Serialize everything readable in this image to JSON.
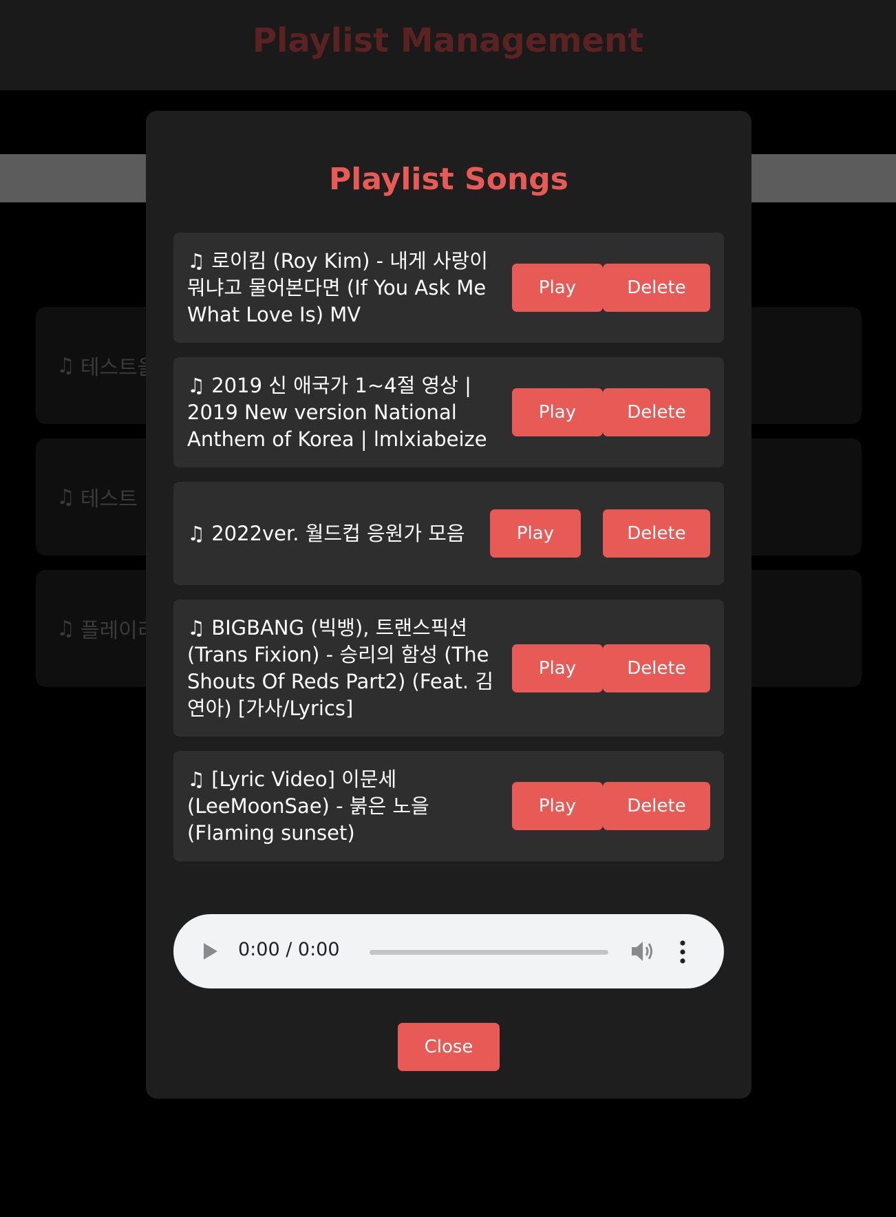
{
  "background": {
    "title": "Playlist Management",
    "cards": [
      {
        "label": "테스트을"
      },
      {
        "label": "테스트"
      },
      {
        "label": "플레이리"
      }
    ]
  },
  "modal": {
    "title": "Playlist Songs",
    "songs": [
      {
        "title": "로이킴 (Roy Kim) - 내게 사랑이 뭐냐고 물어본다면 (If You Ask Me What Love Is) MV",
        "play_label": "Play",
        "delete_label": "Delete"
      },
      {
        "title": "2019 신 애국가 1~4절 영상 | 2019 New version National Anthem of Korea | lmlxiabeize",
        "play_label": "Play",
        "delete_label": "Delete"
      },
      {
        "title": "2022ver. 월드컵 응원가 모음",
        "play_label": "Play",
        "delete_label": "Delete"
      },
      {
        "title": "BIGBANG (빅뱅), 트랜스픽션 (Trans Fixion) - 승리의 함성 (The Shouts Of Reds Part2) (Feat. 김연아) [가사/Lyrics]",
        "play_label": "Play",
        "delete_label": "Delete"
      },
      {
        "title": "[Lyric Video] 이문세 (LeeMoonSae) - 붉은 노을 (Flaming sunset)",
        "play_label": "Play",
        "delete_label": "Delete"
      }
    ],
    "audio_player": {
      "time": "0:00 / 0:00",
      "progress": 0
    },
    "close_label": "Close"
  },
  "icons": {
    "song": "musical-note-icon",
    "audio_play": "play-icon",
    "audio_volume": "volume-icon",
    "audio_menu": "more-vertical-icon"
  },
  "colors": {
    "accent": "#e85a55",
    "modal_bg": "#1e1e1e",
    "item_bg": "#2e2e2e"
  }
}
